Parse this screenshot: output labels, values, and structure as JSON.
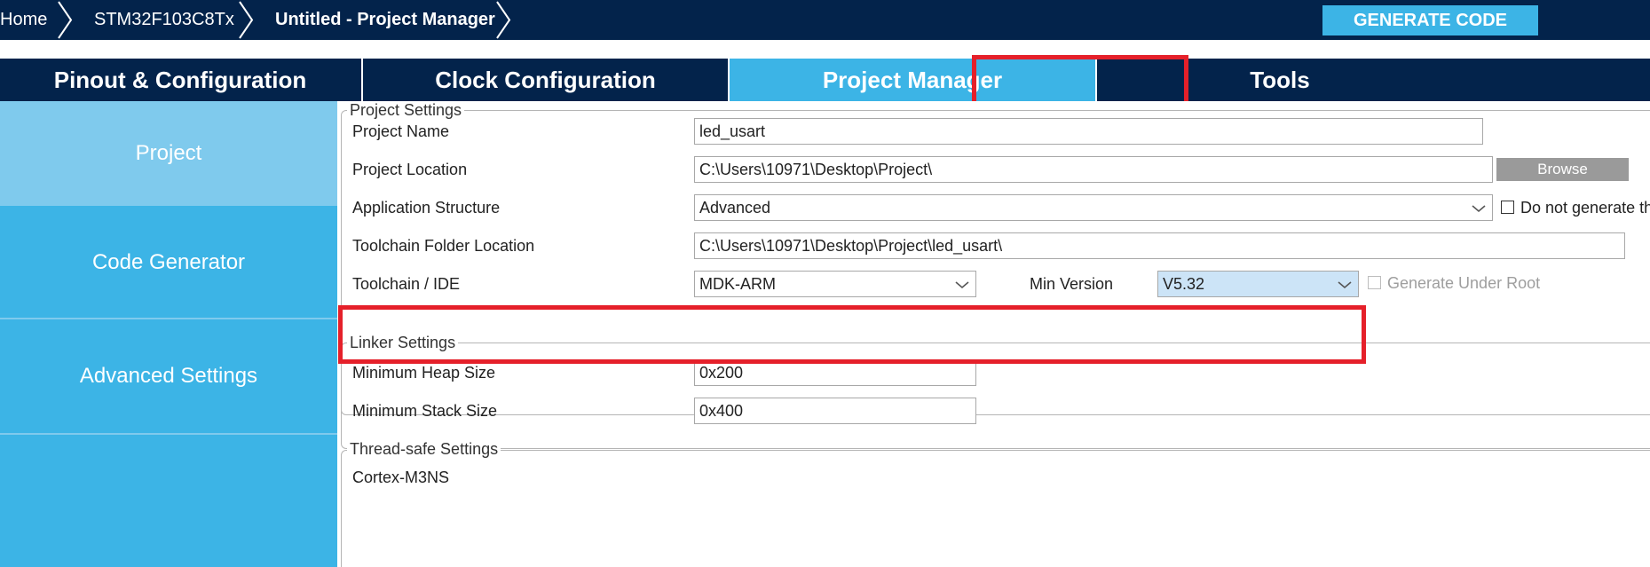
{
  "breadcrumb": {
    "home": "Home",
    "device": "STM32F103C8Tx",
    "current": "Untitled - Project Manager"
  },
  "header": {
    "generate_label": "GENERATE CODE"
  },
  "tabs": [
    {
      "label": "Pinout & Configuration",
      "active": false
    },
    {
      "label": "Clock Configuration",
      "active": false
    },
    {
      "label": "Project Manager",
      "active": true
    },
    {
      "label": "Tools",
      "active": false
    }
  ],
  "sidebar": {
    "items": [
      {
        "label": "Project",
        "active": true
      },
      {
        "label": "Code Generator",
        "active": false
      },
      {
        "label": "Advanced Settings",
        "active": false
      }
    ]
  },
  "project_settings": {
    "legend": "Project Settings",
    "project_name_label": "Project Name",
    "project_name_value": "led_usart",
    "project_location_label": "Project Location",
    "project_location_value": "C:\\Users\\10971\\Desktop\\Project\\",
    "browse_label": "Browse",
    "app_structure_label": "Application Structure",
    "app_structure_value": "Advanced",
    "no_main_label": "Do not generate the main()",
    "no_main_checked": false,
    "toolchain_folder_label": "Toolchain Folder Location",
    "toolchain_folder_value": "C:\\Users\\10971\\Desktop\\Project\\led_usart\\",
    "toolchain_ide_label": "Toolchain / IDE",
    "toolchain_ide_value": "MDK-ARM",
    "min_version_label": "Min Version",
    "min_version_value": "V5.32",
    "gen_under_root_label": "Generate Under Root",
    "gen_under_root_checked": false
  },
  "linker_settings": {
    "legend": "Linker Settings",
    "heap_label": "Minimum Heap Size",
    "heap_value": "0x200",
    "stack_label": "Minimum Stack Size",
    "stack_value": "0x400"
  },
  "thread_settings": {
    "legend": "Thread-safe Settings",
    "core_label": "Cortex-M3NS"
  },
  "colors": {
    "navy": "#03234b",
    "accent": "#3cb4e6",
    "sidebar_active": "#7fcaed",
    "highlight": "#e5202a"
  }
}
